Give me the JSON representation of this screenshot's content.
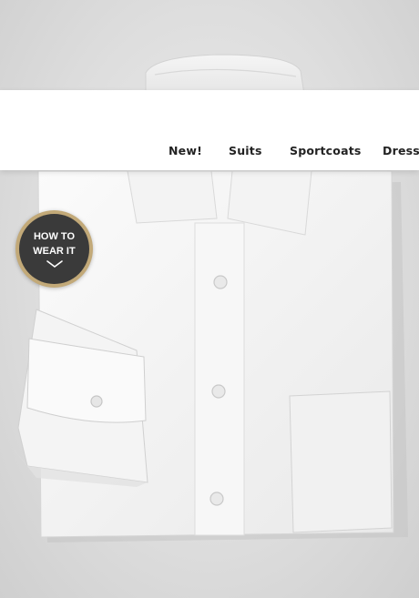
{
  "nav": {
    "items": [
      {
        "label": "New!"
      },
      {
        "label": "Suits"
      },
      {
        "label": "Sportcoats"
      },
      {
        "label": "Dress Shirts"
      }
    ]
  },
  "badge": {
    "line1": "HOW TO",
    "line2": "WEAR IT",
    "icon": "chevron-down-icon"
  },
  "colors": {
    "badge_ring": "#c2a978",
    "badge_fill": "#3a3a3a",
    "nav_background": "#ffffff",
    "nav_text": "#222222"
  }
}
